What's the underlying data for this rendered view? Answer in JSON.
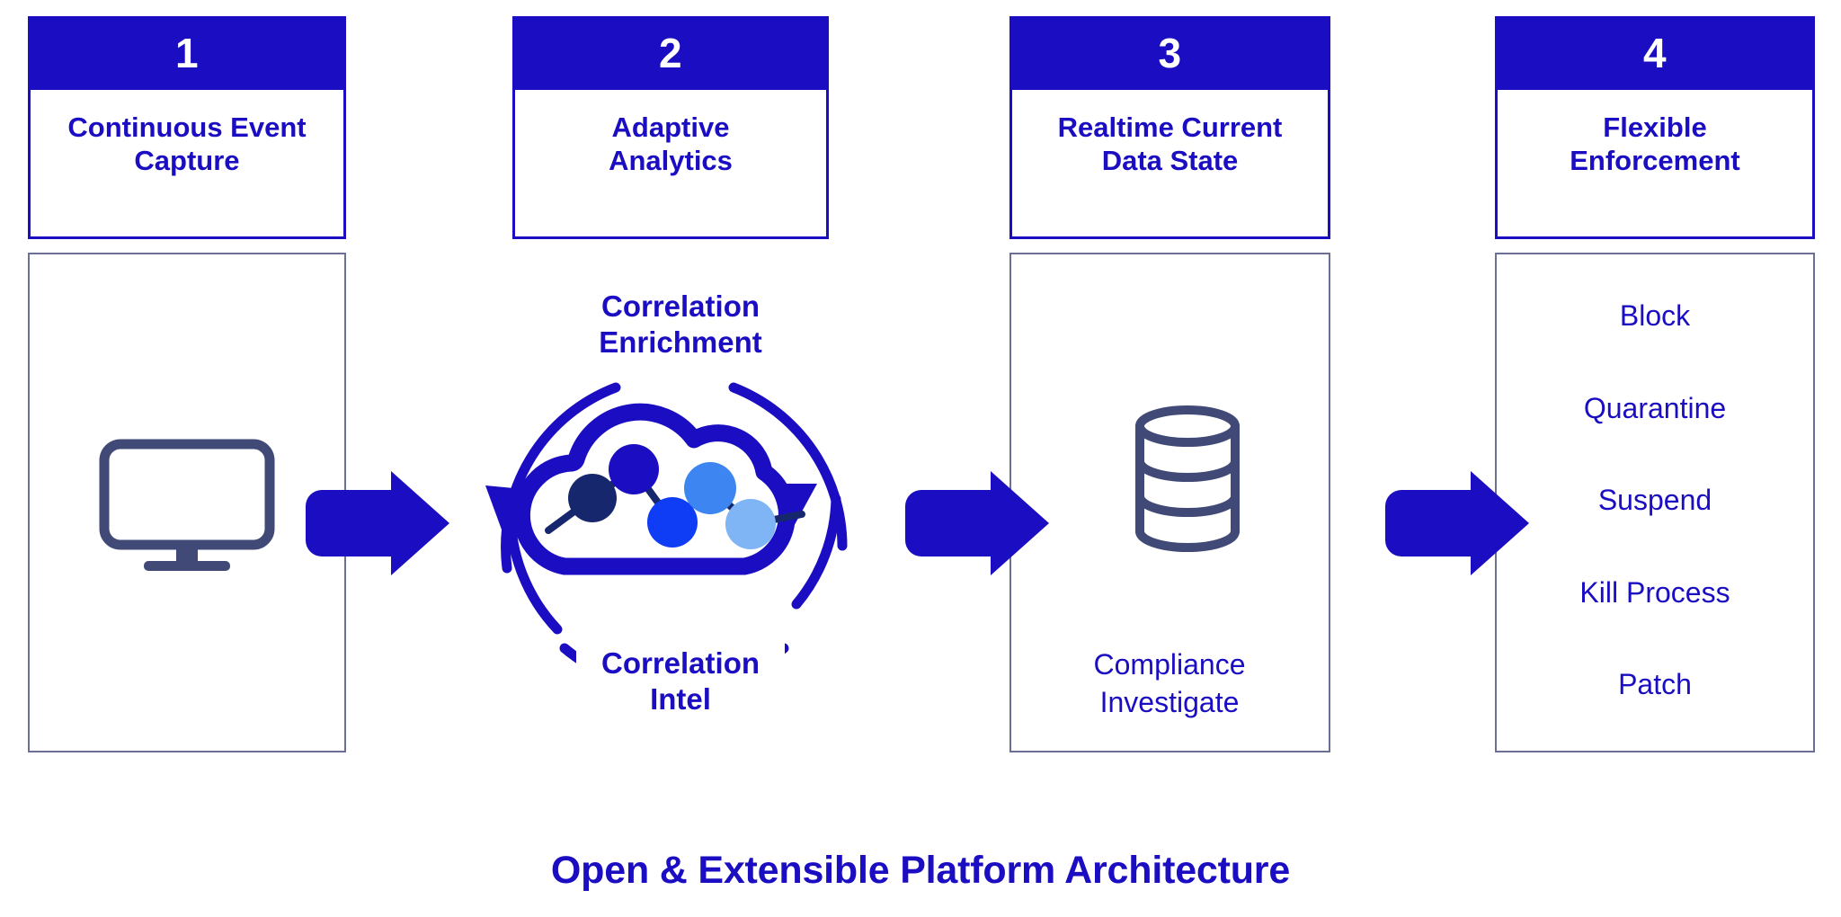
{
  "diagram": {
    "title": "Open & Extensible Platform Architecture",
    "accent_blue": "#1a0dc2",
    "outline_gray": "#6b6f96",
    "icon_gray": "#414a77",
    "columns": [
      {
        "number": "1",
        "title_line1": "Continuous Event",
        "title_line2": "Capture",
        "icon": "monitor-icon"
      },
      {
        "number": "2",
        "title_line1": "Adaptive",
        "title_line2": "Analytics",
        "icon": "cloud-analytics-icon"
      },
      {
        "number": "3",
        "title_line1": "Realtime Current",
        "title_line2": "Data State",
        "icon": "database-icon"
      },
      {
        "number": "4",
        "title_line1": "Flexible",
        "title_line2": "Enforcement",
        "icon": "none"
      }
    ],
    "correlation": {
      "top_line1": "Correlation",
      "top_line2": "Enrichment",
      "bottom_line1": "Correlation",
      "bottom_line2": "Intel"
    },
    "column3_caption": {
      "line1": "Compliance",
      "line2": "Investigate"
    },
    "enforcement_actions": [
      "Block",
      "Quarantine",
      "Suspend",
      "Kill Process",
      "Patch"
    ],
    "node_colors": [
      "#16276e",
      "#1a0dc2",
      "#0f3df5",
      "#3d85f0",
      "#7fb4f5"
    ],
    "arrows": [
      {
        "name": "arrow-capture-to-analytics",
        "direction": "right"
      },
      {
        "name": "arrow-analytics-to-datastate",
        "direction": "right"
      },
      {
        "name": "arrow-datastate-to-enforcement",
        "direction": "right"
      },
      {
        "name": "arrow-correlation-up",
        "direction": "up-curved"
      },
      {
        "name": "arrow-correlation-down",
        "direction": "down-curved"
      }
    ]
  }
}
